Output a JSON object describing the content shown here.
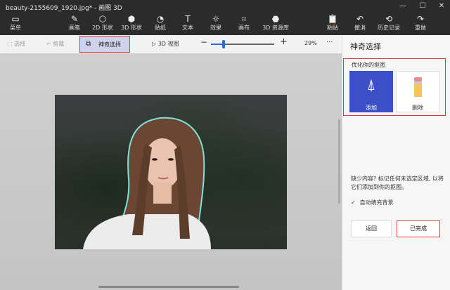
{
  "window": {
    "title": "beauty-2155609_1920.jpg* - 画图 3D"
  },
  "ribbon": {
    "items": [
      {
        "label": "菜单",
        "icon": "folder-icon"
      },
      {
        "label": "画笔",
        "icon": "brush-icon"
      },
      {
        "label": "2D 形状",
        "icon": "shape-2d-icon"
      },
      {
        "label": "3D 形状",
        "icon": "shape-3d-icon"
      },
      {
        "label": "贴纸",
        "icon": "sticker-icon"
      },
      {
        "label": "文本",
        "icon": "text-icon"
      },
      {
        "label": "效果",
        "icon": "effects-icon"
      },
      {
        "label": "画布",
        "icon": "canvas-icon"
      },
      {
        "label": "3D 资源库",
        "icon": "library-icon"
      },
      {
        "label": "粘贴",
        "icon": "paste-icon"
      },
      {
        "label": "撤消",
        "icon": "undo-icon"
      },
      {
        "label": "历史记录",
        "icon": "history-icon"
      },
      {
        "label": "重做",
        "icon": "redo-icon"
      }
    ]
  },
  "toolbar": {
    "select": "选择",
    "crop": "剪裁",
    "magic_select": "神奇选择",
    "view_3d": "3D 视图",
    "zoom": "29%",
    "zoom_fraction": 0.2
  },
  "panel": {
    "title": "神奇选择",
    "refine_label": "优化你的抠图",
    "add": "添加",
    "remove": "删除",
    "hint": "缺少内容? 标记任何未选定区域, 以将它们添加到你的抠图。",
    "autofill": "自动填充背景",
    "back": "返回",
    "done": "已完成"
  }
}
